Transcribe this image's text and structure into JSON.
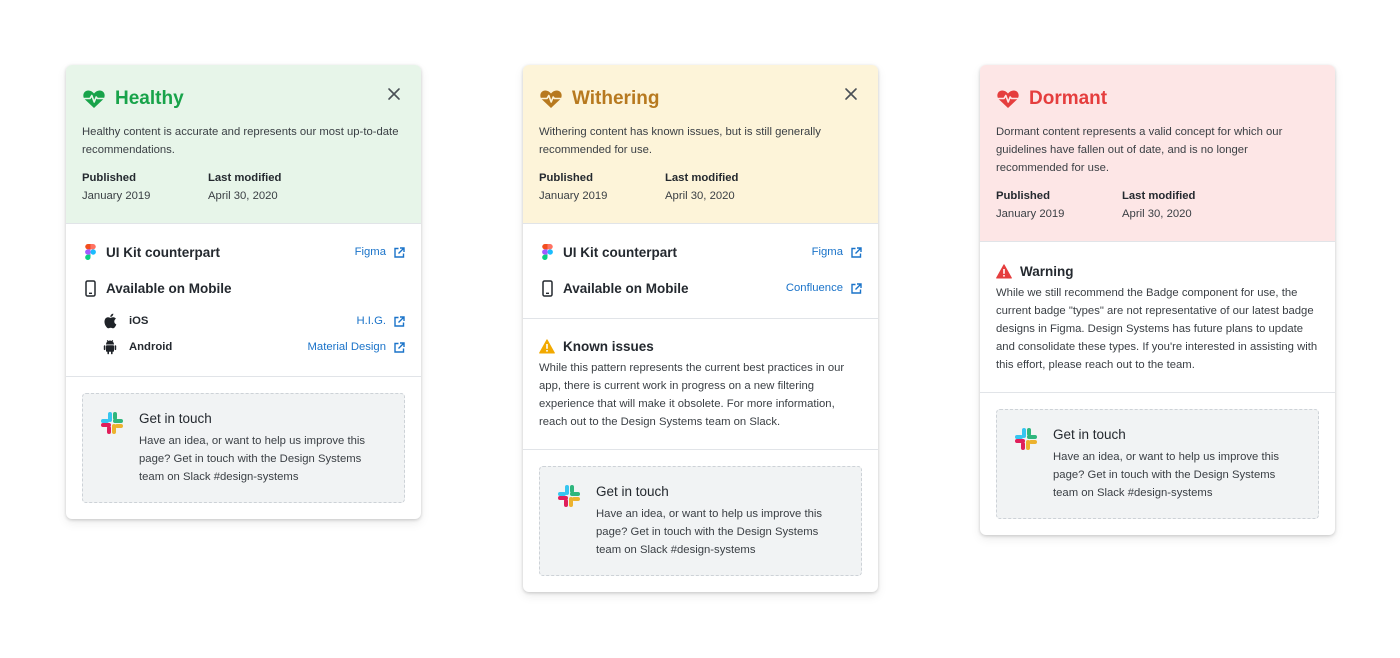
{
  "colors": {
    "healthy": "#18a34a",
    "withering": "#b7791f",
    "dormant": "#e53e3e",
    "link": "#1a73c9",
    "warning": "#f2a900"
  },
  "cards": [
    {
      "title": "Healthy",
      "description": "Healthy content is accurate and represents our most up-to-date recommendations.",
      "published_label": "Published",
      "published_value": "January 2019",
      "modified_label": "Last modified",
      "modified_value": "April 30, 2020",
      "resources": [
        {
          "label": "UI Kit counterpart",
          "link": "Figma",
          "icon": "figma-icon"
        },
        {
          "label": "Available on Mobile",
          "icon": "mobile-icon"
        }
      ],
      "platforms": [
        {
          "label": "iOS",
          "link": "H.I.G.",
          "icon": "apple-icon"
        },
        {
          "label": "Android",
          "link": "Material Design",
          "icon": "android-icon"
        }
      ],
      "touch": {
        "title": "Get in touch",
        "body": "Have an idea, or want to help us improve this page? Get in touch with the Design Systems team on Slack #design-systems"
      }
    },
    {
      "title": "Withering",
      "description": "Withering content has known issues, but is still generally recommended for use.",
      "published_label": "Published",
      "published_value": "January 2019",
      "modified_label": "Last modified",
      "modified_value": "April 30, 2020",
      "resources": [
        {
          "label": "UI Kit counterpart",
          "link": "Figma",
          "icon": "figma-icon"
        },
        {
          "label": "Available on Mobile",
          "link": "Confluence",
          "icon": "mobile-icon"
        }
      ],
      "warning": {
        "title": "Known issues",
        "body": "While this pattern represents the current best practices in our app, there is current work in progress on a new filtering experience that will make it obsolete. For more information, reach out to the Design Systems team on Slack."
      },
      "touch": {
        "title": "Get in touch",
        "body": "Have an idea, or want to help us improve this page? Get in touch with the Design Systems team on Slack #design-systems"
      }
    },
    {
      "title": "Dormant",
      "description": "Dormant content represents a valid concept for which our guidelines have fallen out of date, and is no longer recommended for use.",
      "published_label": "Published",
      "published_value": "January 2019",
      "modified_label": "Last modified",
      "modified_value": "April 30, 2020",
      "warning": {
        "title": "Warning",
        "body": "While we still recommend the Badge component for use, the current badge \"types\" are not representative of our latest badge designs in Figma. Design Systems has future plans to update and consolidate these types. If you're interested in assisting with this effort, please reach out to the team."
      },
      "touch": {
        "title": "Get in touch",
        "body": "Have an idea, or want to help us improve this page? Get in touch with the Design Systems team on Slack #design-systems"
      }
    }
  ]
}
